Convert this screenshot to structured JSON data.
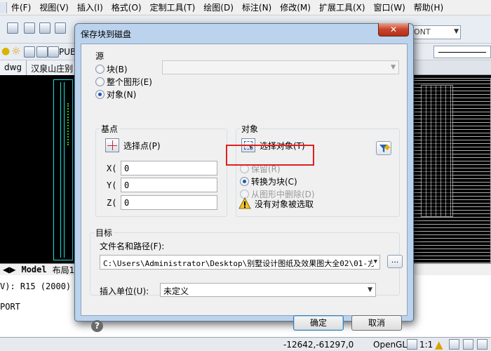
{
  "app": {
    "menus": [
      "件(F)",
      "视图(V)",
      "插入(I)",
      "格式(O)",
      "定制工具(T)",
      "绘图(D)",
      "标注(N)",
      "修改(M)",
      "扩展工具(X)",
      "窗口(W)",
      "帮助(H)"
    ],
    "font_combo": "ONT",
    "layer_text": "PUB",
    "doc_tabs": [
      "dwg",
      "汉泉山庄别"
    ],
    "layout_tabs": [
      "Model",
      "布局1"
    ],
    "command_lines": [
      "V): R15 (2000) r",
      "PORT"
    ],
    "status": {
      "coords": "-12642,-61297,0",
      "opengl": "OpenGL",
      "scale": "1:1"
    }
  },
  "dialog": {
    "title": "保存块到磁盘",
    "close": "✕",
    "source": {
      "label": "源",
      "options": [
        "块(B)",
        "整个图形(E)",
        "对象(N)"
      ],
      "selected": "对象(N)"
    },
    "base_point": {
      "label": "基点",
      "pick_button": "选择点(P)",
      "x_label": "X(",
      "y_label": "Y(",
      "z_label": "Z(",
      "x": "0",
      "y": "0",
      "z": "0"
    },
    "objects": {
      "label": "对象",
      "select_button": "选择对象(T)",
      "options": [
        "保留(R)",
        "转换为块(C)",
        "从图形中删除(D)"
      ],
      "selected": "转换为块(C)",
      "warning": "没有对象被选取"
    },
    "target": {
      "label": "目标",
      "path_label": "文件名和路径(F):",
      "path_value": "C:\\Users\\Administrator\\Desktop\\别墅设计图纸及效果图大全02\\01-方",
      "browse": "...",
      "unit_label": "插入单位(U):",
      "unit_value": "未定义"
    },
    "ok": "确定",
    "cancel": "取消",
    "help": "?"
  }
}
